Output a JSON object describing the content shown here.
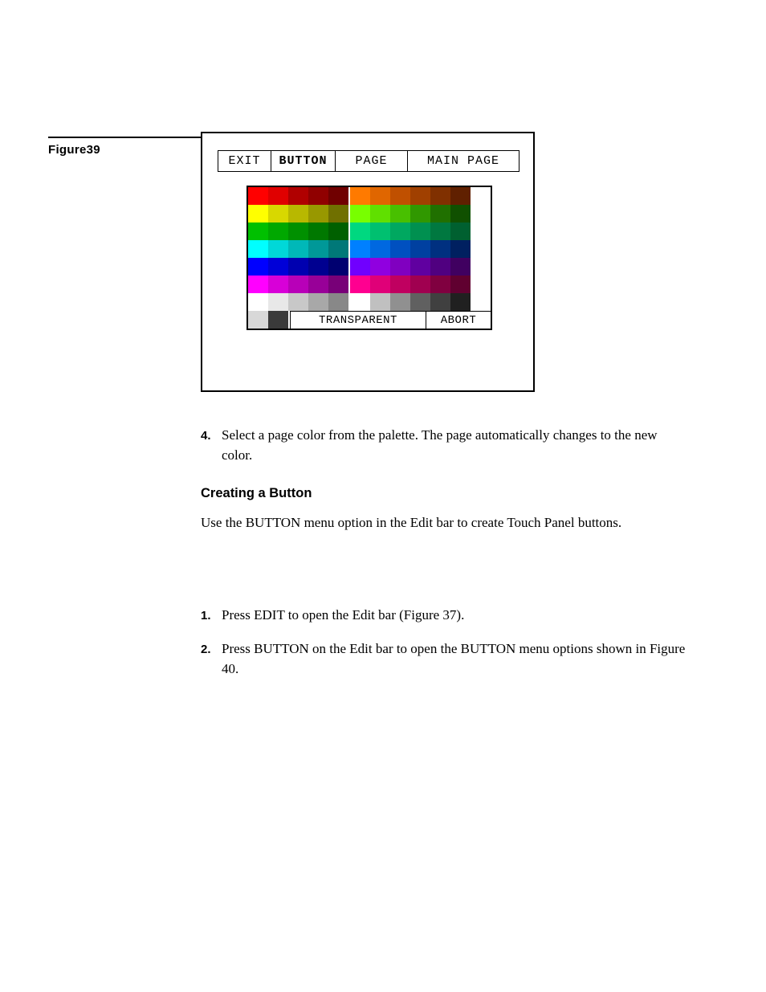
{
  "figure": {
    "label": "Figure39",
    "menu": {
      "exit": "EXIT",
      "button": "BUTTON",
      "page": "PAGE",
      "main_page": "MAIN PAGE"
    },
    "palette": {
      "transparent_label": "TRANSPARENT",
      "abort_label": "ABORT",
      "rows": [
        [
          "#ff0000",
          "#e00000",
          "#b00000",
          "#900000",
          "#700000",
          "#ff7a00",
          "#e06600",
          "#c05000",
          "#a04000",
          "#803000",
          "#602000"
        ],
        [
          "#ffff00",
          "#d8d800",
          "#b8b800",
          "#989800",
          "#707000",
          "#78ff00",
          "#60e000",
          "#48c000",
          "#309800",
          "#207000",
          "#105000"
        ],
        [
          "#00c000",
          "#00a800",
          "#009000",
          "#007800",
          "#006000",
          "#00d880",
          "#00c070",
          "#00a860",
          "#009050",
          "#007840",
          "#006030"
        ],
        [
          "#00ffff",
          "#00d8d8",
          "#00b8b8",
          "#009898",
          "#007878",
          "#0080ff",
          "#0068e0",
          "#0050c0",
          "#0040a0",
          "#003080",
          "#002060"
        ],
        [
          "#0000ff",
          "#0000d8",
          "#0000b0",
          "#000090",
          "#000070",
          "#7000ff",
          "#9000e0",
          "#8000c0",
          "#6000a0",
          "#500080",
          "#400060"
        ],
        [
          "#ff00ff",
          "#d800d8",
          "#b800b8",
          "#980098",
          "#780078",
          "#ff0090",
          "#e00078",
          "#c00060",
          "#a00050",
          "#800040",
          "#600030"
        ],
        [
          "#ffffff",
          "#e8e8e8",
          "#c8c8c8",
          "#a8a8a8",
          "#888888",
          "#ffffff",
          "#c0c0c0",
          "#909090",
          "#606060",
          "#404040",
          "#202020"
        ]
      ]
    }
  },
  "body": {
    "step4": "Select a page color from the palette. The page automatically changes to the new color.",
    "heading": "Creating a Button",
    "intro": "Use the BUTTON menu option in the Edit bar to create Touch Panel buttons.",
    "step1": "Press EDIT to open the Edit bar (Figure 37).",
    "step2": "Press BUTTON on the Edit bar to open the BUTTON menu options shown in Figure 40.",
    "num4": "4.",
    "num1": "1.",
    "num2": "2."
  }
}
